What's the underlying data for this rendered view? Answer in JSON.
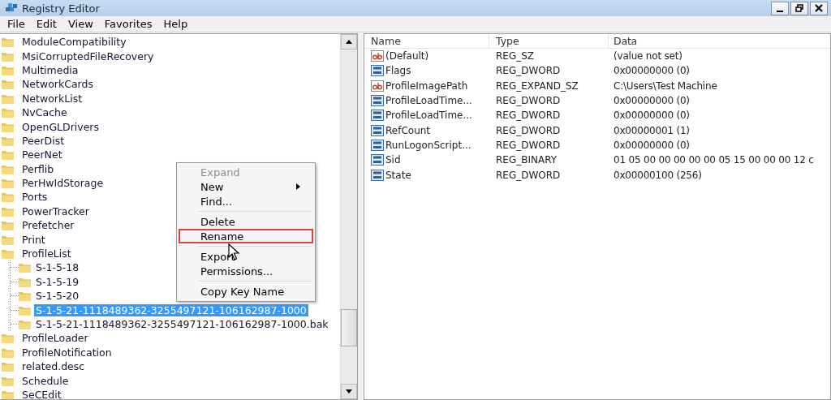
{
  "window": {
    "title": "Registry Editor"
  },
  "menu_bar": [
    "File",
    "Edit",
    "View",
    "Favorites",
    "Help"
  ],
  "tree": [
    {
      "label": "ModuleCompatibility",
      "selected": false
    },
    {
      "label": "MsiCorruptedFileRecovery",
      "selected": false
    },
    {
      "label": "Multimedia",
      "selected": false
    },
    {
      "label": "NetworkCards",
      "selected": false
    },
    {
      "label": "NetworkList",
      "selected": false
    },
    {
      "label": "NvCache",
      "selected": false
    },
    {
      "label": "OpenGLDrivers",
      "selected": false
    },
    {
      "label": "PeerDist",
      "selected": false
    },
    {
      "label": "PeerNet",
      "selected": false
    },
    {
      "label": "Perflib",
      "selected": false
    },
    {
      "label": "PerHwIdStorage",
      "selected": false
    },
    {
      "label": "Ports",
      "selected": false
    },
    {
      "label": "PowerTracker",
      "selected": false
    },
    {
      "label": "Prefetcher",
      "selected": false
    },
    {
      "label": "Print",
      "selected": false
    },
    {
      "label": "ProfileList",
      "selected": false,
      "children": [
        {
          "label": "S-1-5-18",
          "selected": false
        },
        {
          "label": "S-1-5-19",
          "selected": false
        },
        {
          "label": "S-1-5-20",
          "selected": false
        },
        {
          "label": "S-1-5-21-1118489362-3255497121-106162987-1000",
          "selected": true
        },
        {
          "label": "S-1-5-21-1118489362-3255497121-106162987-1000.bak",
          "selected": false
        }
      ]
    },
    {
      "label": "ProfileLoader",
      "selected": false
    },
    {
      "label": "ProfileNotification",
      "selected": false
    },
    {
      "label": "related.desc",
      "selected": false
    },
    {
      "label": "Schedule",
      "selected": false
    },
    {
      "label": "SeCEdit",
      "selected": false
    }
  ],
  "values": {
    "columns": [
      "Name",
      "Type",
      "Data"
    ],
    "rows": [
      {
        "kind": "string",
        "name": "(Default)",
        "type": "REG_SZ",
        "data": "(value not set)"
      },
      {
        "kind": "binary",
        "name": "Flags",
        "type": "REG_DWORD",
        "data": "0x00000000 (0)"
      },
      {
        "kind": "string",
        "name": "ProfileImagePath",
        "type": "REG_EXPAND_SZ",
        "data": "C:\\Users\\Test Machine"
      },
      {
        "kind": "binary",
        "name": "ProfileLoadTime...",
        "type": "REG_DWORD",
        "data": "0x00000000 (0)"
      },
      {
        "kind": "binary",
        "name": "ProfileLoadTime...",
        "type": "REG_DWORD",
        "data": "0x00000000 (0)"
      },
      {
        "kind": "binary",
        "name": "RefCount",
        "type": "REG_DWORD",
        "data": "0x00000001 (1)"
      },
      {
        "kind": "binary",
        "name": "RunLogonScript...",
        "type": "REG_DWORD",
        "data": "0x00000000 (0)"
      },
      {
        "kind": "binary",
        "name": "Sid",
        "type": "REG_BINARY",
        "data": "01 05 00 00 00 00 00 05 15 00 00 00 12 c"
      },
      {
        "kind": "binary",
        "name": "State",
        "type": "REG_DWORD",
        "data": "0x00000100 (256)"
      }
    ]
  },
  "context_menu": [
    [
      {
        "label": "Expand",
        "disabled": true,
        "submenu": false,
        "highlighted": false
      },
      {
        "label": "New",
        "disabled": false,
        "submenu": true,
        "highlighted": false
      },
      {
        "label": "Find...",
        "disabled": false,
        "submenu": false,
        "highlighted": false
      }
    ],
    [
      {
        "label": "Delete",
        "disabled": false,
        "submenu": false,
        "highlighted": false
      },
      {
        "label": "Rename",
        "disabled": false,
        "submenu": false,
        "highlighted": true
      }
    ],
    [
      {
        "label": "Export",
        "disabled": false,
        "submenu": false,
        "highlighted": false
      },
      {
        "label": "Permissions...",
        "disabled": false,
        "submenu": false,
        "highlighted": false
      }
    ],
    [
      {
        "label": "Copy Key Name",
        "disabled": false,
        "submenu": false,
        "highlighted": false
      }
    ]
  ]
}
